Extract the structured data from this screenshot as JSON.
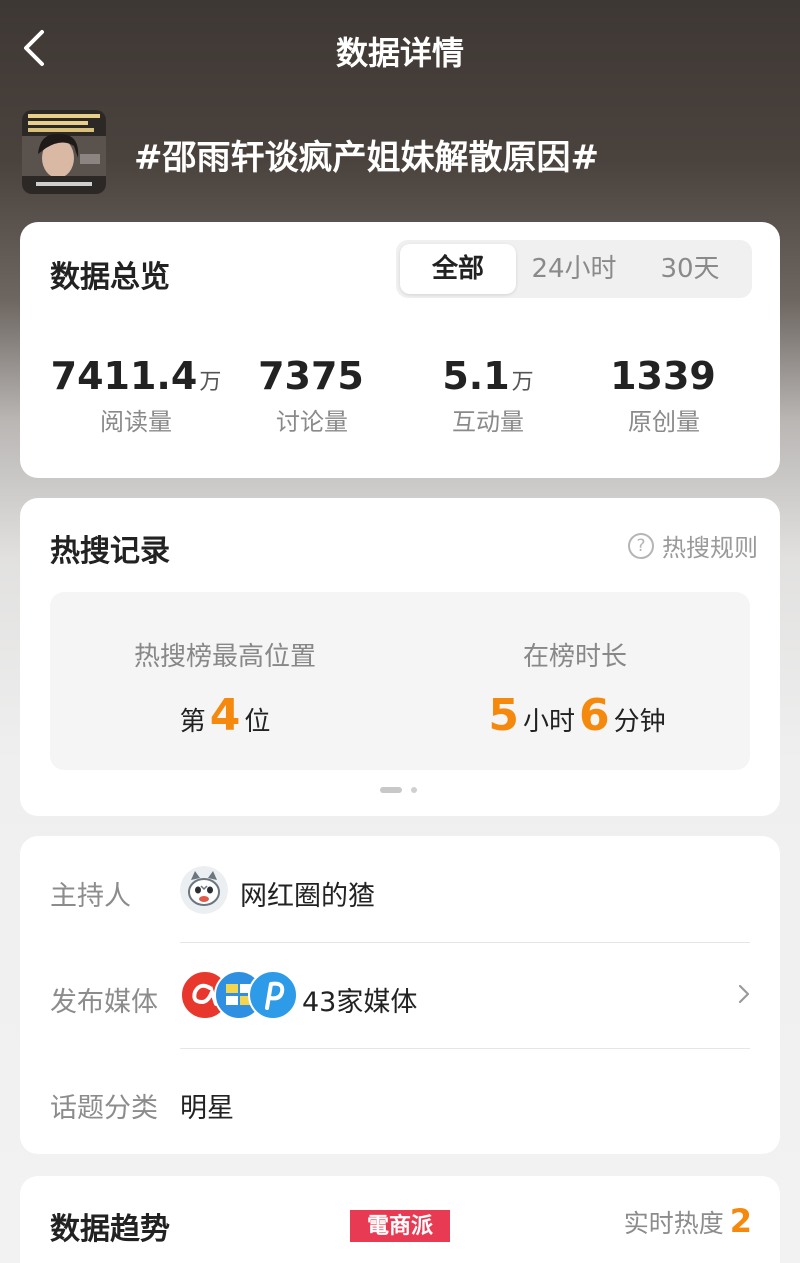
{
  "nav": {
    "title": "数据详情"
  },
  "topic": {
    "title": "#邵雨轩谈疯产姐妹解散原因#"
  },
  "overview": {
    "title": "数据总览",
    "tabs": [
      {
        "label": "全部",
        "active": true
      },
      {
        "label": "24小时",
        "active": false
      },
      {
        "label": "30天",
        "active": false
      }
    ],
    "stats": [
      {
        "value": "7411.4",
        "unit": "万",
        "label": "阅读量"
      },
      {
        "value": "7375",
        "unit": "",
        "label": "讨论量"
      },
      {
        "value": "5.1",
        "unit": "万",
        "label": "互动量"
      },
      {
        "value": "1339",
        "unit": "",
        "label": "原创量"
      }
    ]
  },
  "hot_search": {
    "title": "热搜记录",
    "rule_label": "热搜规则",
    "best_rank": {
      "label": "热搜榜最高位置",
      "prefix": "第",
      "value": "4",
      "suffix": "位"
    },
    "duration": {
      "label": "在榜时长",
      "hours": "5",
      "hours_unit": "小时",
      "minutes": "6",
      "minutes_unit": "分钟"
    }
  },
  "info": {
    "host": {
      "label": "主持人",
      "value": "网红圈的猹"
    },
    "media": {
      "label": "发布媒体",
      "value": "43家媒体"
    },
    "category": {
      "label": "话题分类",
      "value": "明星"
    }
  },
  "trend": {
    "title": "数据趋势",
    "realtime_label": "实时热度",
    "realtime_value": "2"
  },
  "watermark": "電商派",
  "colors": {
    "accent": "#f5890e",
    "card": "#ffffff",
    "watermark": "#e83a52"
  }
}
